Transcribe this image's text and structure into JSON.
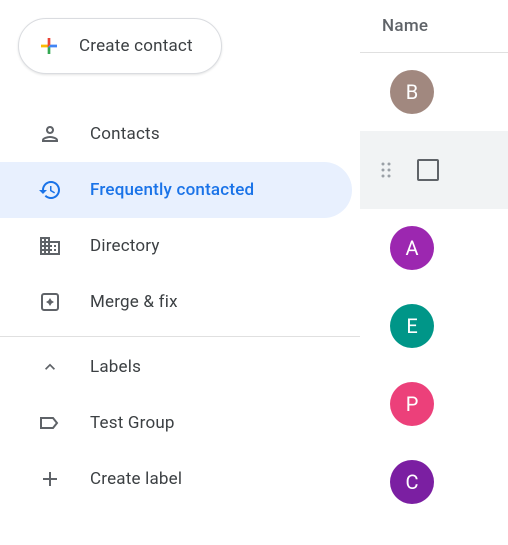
{
  "create_button": {
    "label": "Create contact"
  },
  "nav": {
    "contacts": {
      "label": "Contacts"
    },
    "frequently": {
      "label": "Frequently contacted",
      "active": true
    },
    "directory": {
      "label": "Directory"
    },
    "merge": {
      "label": "Merge & fix"
    }
  },
  "secondary": {
    "labels": {
      "label": "Labels"
    },
    "test_group": {
      "label": "Test Group"
    },
    "create_label": {
      "label": "Create label"
    }
  },
  "header": {
    "name_label": "Name"
  },
  "contacts": [
    {
      "initial": "B",
      "color": "#a1887f",
      "hovered": false
    },
    {
      "initial": "",
      "color": "",
      "hovered": true
    },
    {
      "initial": "A",
      "color": "#9c27b0",
      "hovered": false
    },
    {
      "initial": "E",
      "color": "#009688",
      "hovered": false
    },
    {
      "initial": "P",
      "color": "#ec407a",
      "hovered": false
    },
    {
      "initial": "C",
      "color": "#7b1fa2",
      "hovered": false
    }
  ]
}
